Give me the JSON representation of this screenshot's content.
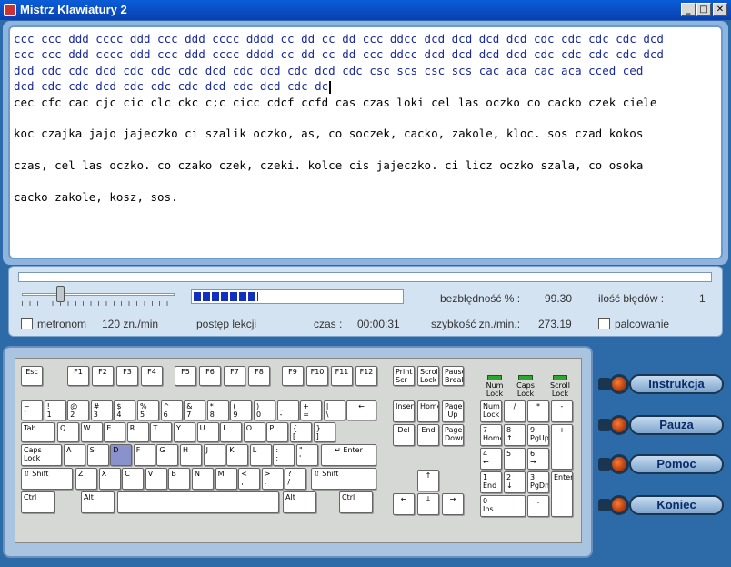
{
  "window": {
    "title": "Mistrz Klawiatury 2",
    "min": "_",
    "max": "□",
    "close": "✕"
  },
  "text": {
    "typed_lines": [
      "ccc ccc ddd cccc ddd ccc ddd cccc dddd cc dd cc dd ccc ddcc dcd dcd dcd dcd cdc cdc cdc cdc dcd",
      "ccc ccc ddd cccc ddd ccc ddd cccc dddd cc dd cc dd ccc ddcc dcd dcd dcd dcd cdc cdc cdc cdc dcd",
      "dcd cdc cdc dcd cdc cdc cdc dcd cdc dcd cdc dcd cdc csc scs csc scs cac aca cac aca cced ced",
      "dcd cdc cdc dcd cdc cdc cdc dcd cdc dcd cdc dc"
    ],
    "pending_lines": [
      "cec cfc cac cjc cic clc ckc c;c cicc cdcf ccfd cas czas loki cel las oczko co cacko czek ciele",
      "koc czajka jajo jajeczko ci szalik oczko, as, co soczek, cacko, zakole, kloc. sos czad kokos",
      "czas, cel las oczko. co czako czek, czeki. kolce cis jajeczko. ci licz oczko szala, co osoka",
      "cacko zakole, kosz, sos."
    ]
  },
  "stats": {
    "metronom_label": "metronom",
    "metronom_speed": "120 zn./min",
    "progress_label": "postęp lekcji",
    "progress_fraction": 0.31,
    "time_label": "czas :",
    "time_value": "00:00:31",
    "accuracy_label": "bezbłędność % :",
    "accuracy_value": "99.30",
    "errors_label": "ilość błędów :",
    "errors_value": "1",
    "speed_label": "szybkość zn./min.:",
    "speed_value": "273.19",
    "fingering_label": "palcowanie"
  },
  "keyboard": {
    "highlight_key": "D",
    "leds": [
      "Num Lock",
      "Caps Lock",
      "Scroll Lock"
    ]
  },
  "side_buttons": [
    "Instrukcja",
    "Pauza",
    "Pomoc",
    "Koniec"
  ],
  "colors": {
    "accent": "#1230c0",
    "highlight": "#8a92cc",
    "led": "#2fa52f"
  }
}
